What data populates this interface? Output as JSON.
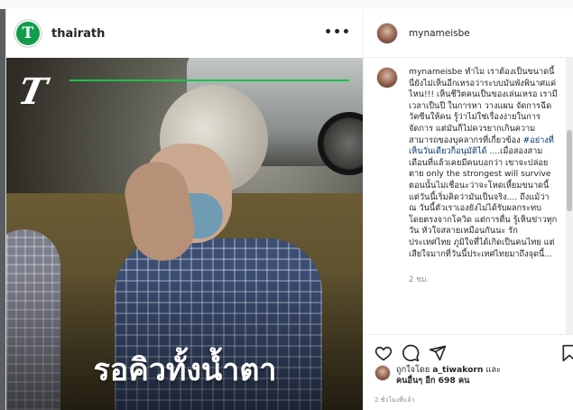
{
  "post": {
    "username": "thairath",
    "avatar_letter": "T",
    "more_glyph": "•••",
    "logo_text": "T",
    "overlay_caption": "รอคิวทั้งน้ำตา"
  },
  "side": {
    "username": "mynameisbe",
    "comment_user": "mynameisbe",
    "comment_body": " ทำไม เราต้องเป็นขนาดนี้ นี่ยังไม่เห็นอีกเหรอว่าระบบมันพังพินาศแค่ไหน!!! เห็นชีวิตคนเป็นของเล่นเหรอ เรามีเวลาเป็นปี ในการหา วางแผน จัดการฉีดวัคซีนให้คน รู้ว่าไม่ใช่เรื่องง่ายในการจัดการ แต่มันก็ไม่ควรยากเกินความสามารถของบุคลากรที่เกี่ยวข้อง ",
    "comment_tag": "#อย่างที่เห็นวันเดียวก็อนุมัติได้",
    "comment_rest": " ....เมื่อสองสามเดือนที่แล้วเคยมีคนบอกว่า เขาจะปล่อยตาย only the strongest will survive ตอนนั้นไม่เชื่อนะว่าจะโหดเหี้ยมขนาดนี้ แต่วันนี้เริ่มคิดว่ามันเป็นจริง.... ถึงแม้ว่า ณ วันนี้ตัวเราเองยังไม่ได้รับผลกระทบโดยตรงจากโควิด แต่การตื่น รู้เห็นข่าวทุกวัน หัวใจสลายเหมือนกันนะ รักประเทศไทย ภูมิใจที่ได้เกิดเป็นคนไทย แต่เสียใจมากที่วันนี้ประเทศไทยมาถึงจุดนี้...",
    "comment_time": "2 ชม.",
    "likes_prefix": "ถูกใจโดย",
    "likes_user": "a_tiwakorn",
    "likes_and": "และ",
    "likes_others": "คนอื่นๆ อีก 698 คน",
    "post_time": "2 ชั่วโมงที่แล้ว"
  },
  "icons": [
    "more-horizontal-icon",
    "heart-icon",
    "comment-icon",
    "share-icon",
    "bookmark-icon"
  ],
  "colors": {
    "brand_green": "#0f9d4a",
    "link": "#00376b",
    "muted": "#8e8e8e"
  }
}
